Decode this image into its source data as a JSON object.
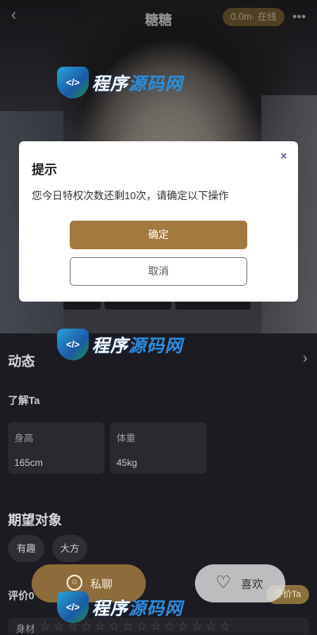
{
  "header": {
    "title": "糖糖",
    "status": "0.0m· 在线",
    "back_icon": "‹",
    "more_icon": "•••"
  },
  "watermark": {
    "text_a": "程序",
    "text_b": "源码网",
    "badge": "</>"
  },
  "dialog": {
    "title": "提示",
    "close_icon": "×",
    "message": "您今日特权次数还剩10次，请确定以下操作",
    "confirm_label": "确定",
    "cancel_label": "取消"
  },
  "profile": {
    "moments_title": "动态",
    "arrow_icon": "›",
    "about_title": "了解Ta",
    "stats": [
      {
        "label": "身高",
        "value": "165cm"
      },
      {
        "label": "体重",
        "value": "45kg"
      }
    ],
    "expect_title": "期望对象",
    "tags": [
      "有趣",
      "大方"
    ],
    "eval_label": "评价0",
    "rate_label": "评价Ta",
    "figure_label": "身材",
    "stars": "☆☆☆☆☆☆☆☆☆☆☆☆☆☆"
  },
  "actions": {
    "chat_label": "私聊",
    "chat_icon": "☺",
    "like_label": "喜欢",
    "like_icon": "♡"
  }
}
